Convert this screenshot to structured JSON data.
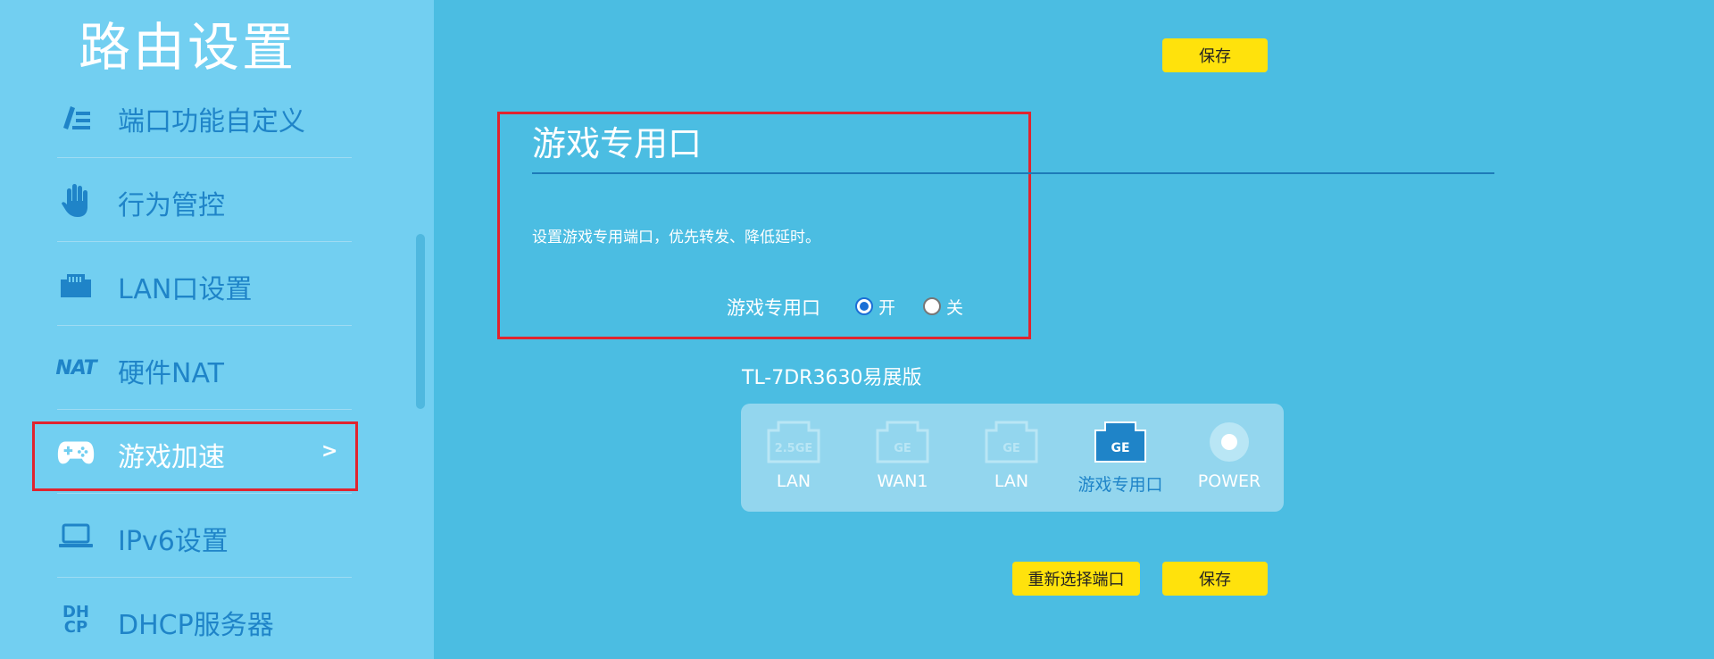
{
  "sidebar": {
    "title": "路由设置",
    "items": [
      {
        "label": "端口功能自定义",
        "icon": "port-customize-icon"
      },
      {
        "label": "行为管控",
        "icon": "hand-icon"
      },
      {
        "label": "LAN口设置",
        "icon": "lan-port-icon"
      },
      {
        "label": "硬件NAT",
        "icon": "nat-icon",
        "icon_text": "NAT"
      },
      {
        "label": "游戏加速",
        "icon": "gamepad-icon",
        "active": true,
        "arrow": ">"
      },
      {
        "label": "IPv6设置",
        "icon": "laptop-icon"
      },
      {
        "label": "DHCP服务器",
        "icon": "dhcp-icon",
        "icon_text": [
          "DH",
          "CP"
        ]
      }
    ]
  },
  "toolbar": {
    "save_label": "保存"
  },
  "section": {
    "title": "游戏专用口",
    "description": "设置游戏专用端口，优先转发、降低延时。",
    "field_label": "游戏专用口",
    "options": [
      {
        "label": "开",
        "checked": true
      },
      {
        "label": "关",
        "checked": false
      }
    ]
  },
  "device": {
    "model": "TL-7DR3630易展版",
    "ports": [
      {
        "label": "LAN",
        "badge": "2.5GE",
        "state": "inactive"
      },
      {
        "label": "WAN1",
        "badge": "GE",
        "state": "inactive"
      },
      {
        "label": "LAN",
        "badge": "GE",
        "state": "inactive"
      },
      {
        "label": "游戏专用口",
        "badge": "GE",
        "state": "active"
      },
      {
        "label": "POWER",
        "badge": "",
        "state": "power"
      }
    ]
  },
  "footer": {
    "reselect_label": "重新选择端口",
    "save_label": "保存"
  },
  "colors": {
    "main_bg": "#4bbde2",
    "sidebar_bg": "#72cff1",
    "nav_text": "#1f84c8",
    "highlight_border": "#e0242f",
    "button": "#ffe20c",
    "port_active": "#1f84c8"
  }
}
